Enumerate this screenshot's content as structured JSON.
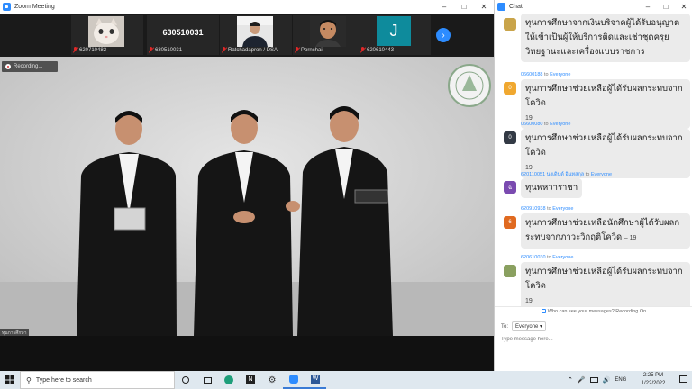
{
  "zoom": {
    "title": "Zoom Meeting",
    "thumbnails": [
      {
        "name": "620710482",
        "type": "video"
      },
      {
        "name": "630510031",
        "type": "name",
        "display": "630510031"
      },
      {
        "name": "Ratchadapron / DSA",
        "type": "video"
      },
      {
        "name": "Pornchai",
        "type": "video"
      },
      {
        "name": "620610443",
        "type": "avatar",
        "initial": "J"
      }
    ],
    "recording_label": "Recording...",
    "speaker_label": "ทุนการศึกษา"
  },
  "chat": {
    "title": "Chat",
    "to_word": "to",
    "messages": [
      {
        "sender": "",
        "to": "",
        "text": "ทุนการศึกษาจากเงินบริจาคผู้ได้รับอนุญาตให้เข้าเป็นผู้ให้บริการติดและเช่าชุดครุยวิทยฐานะและเครื่องแบบราชการ",
        "avatar_color": "#c9a44a",
        "avatar_text": ""
      },
      {
        "sender": "06600188",
        "to": "Everyone",
        "text": "ทุนการศึกษาช่วยเหลือผู้ได้รับผลกระทบจากโควิด",
        "tail": "19",
        "avatar_color": "#f0a830",
        "avatar_text": "0"
      },
      {
        "sender": "06600080",
        "to": "Everyone",
        "text": "ทุนการศึกษาช่วยเหลือผู้ได้รับผลกระทบจากโควิด",
        "tail": "19",
        "avatar_color": "#333a45",
        "avatar_text": "0"
      },
      {
        "sender": "620110051 นงเดินต์ อินทสกุล",
        "to": "Everyone",
        "text": "ทุนพหวาราชา",
        "avatar_color": "#7a4ab0",
        "avatar_text": "ฉ"
      },
      {
        "sender": "620910938",
        "to": "Everyone",
        "text": "ทุนการศึกษาช่วยเหลือนักศึกษาผู้ได้รับผลกระทบจากภาวะวิกฤติโควิด",
        "tail": "– 19",
        "avatar_color": "#e06a20",
        "avatar_text": "6"
      },
      {
        "sender": "620610030",
        "to": "Everyone",
        "text": "ทุนการศึกษาช่วยเหลือผู้ได้รับผลกระทบจากโควิด",
        "tail": "19",
        "avatar_color": "#8aa060",
        "avatar_text": ""
      }
    ],
    "privacy_note": "Who can see your messages? Recording On",
    "to_label": "To:",
    "recipient": "Everyone",
    "input_placeholder": "Type message here..."
  },
  "taskbar": {
    "search_placeholder": "Type here to search",
    "language": "ENG",
    "time": "2:25 PM",
    "date": "1/22/2022"
  }
}
